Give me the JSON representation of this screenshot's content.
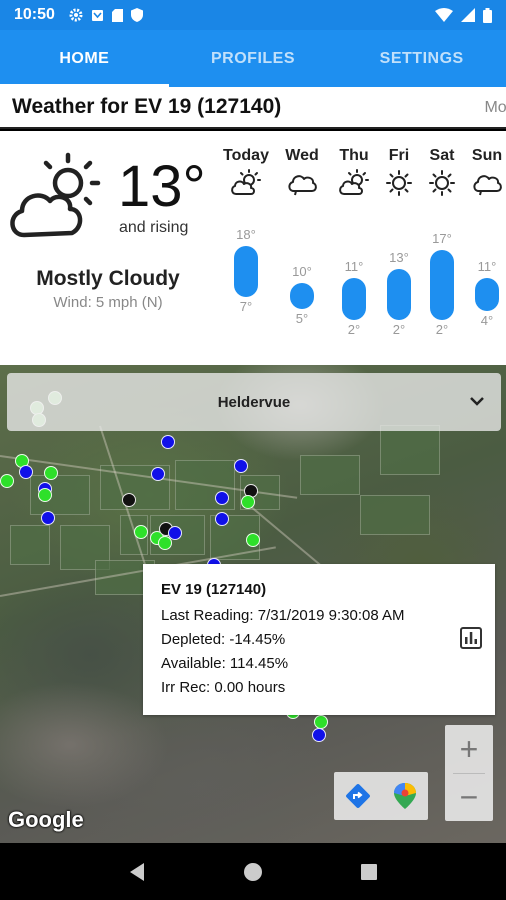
{
  "status_bar": {
    "time": "10:50"
  },
  "tabs": [
    {
      "label": "HOME",
      "active": true
    },
    {
      "label": "PROFILES",
      "active": false
    },
    {
      "label": "SETTINGS",
      "active": false
    }
  ],
  "header": {
    "title": "Weather for EV 19 (127140)",
    "more_label": "Mor"
  },
  "current": {
    "icon": "partly-cloudy-icon",
    "temperature": "13°",
    "trend": "and rising",
    "condition": "Mostly Cloudy",
    "wind": "Wind: 5 mph (N)"
  },
  "forecast": [
    {
      "day": "Today",
      "icon": "partly-sunny-icon",
      "high": "18°",
      "low": "7°",
      "high_value": 18,
      "low_value": 7
    },
    {
      "day": "Wed",
      "icon": "cloud-icon",
      "high": "10°",
      "low": "5°",
      "high_value": 10,
      "low_value": 5
    },
    {
      "day": "Thu",
      "icon": "partly-sunny-icon",
      "high": "11°",
      "low": "2°",
      "high_value": 11,
      "low_value": 2
    },
    {
      "day": "Fri",
      "icon": "sun-icon",
      "high": "13°",
      "low": "2°",
      "high_value": 13,
      "low_value": 2
    },
    {
      "day": "Sat",
      "icon": "sun-icon",
      "high": "17°",
      "low": "2°",
      "high_value": 17,
      "low_value": 2
    },
    {
      "day": "Sun",
      "icon": "cloud-icon",
      "high": "11°",
      "low": "4°",
      "high_value": 11,
      "low_value": 4
    }
  ],
  "map": {
    "farm_selector": "Heldervue",
    "attribution": "Google",
    "popup": {
      "title": "EV 19 (127140)",
      "last_reading": "Last Reading: 7/31/2019 9:30:08 AM",
      "depleted": "Depleted: -14.45%",
      "available": "Available: 114.45%",
      "irr_rec": "Irr Rec: 0.00 hours"
    },
    "zoom_in": "+",
    "zoom_out": "−"
  },
  "colors": {
    "accent": "#1e8ff0",
    "marker_green": "#2ee02a",
    "marker_blue": "#1010e8",
    "marker_black": "#111111"
  }
}
